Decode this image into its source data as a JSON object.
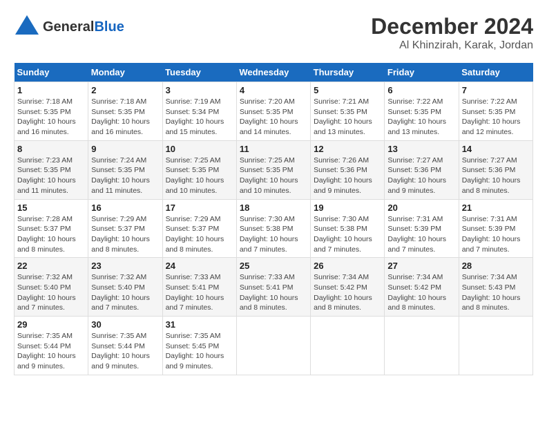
{
  "header": {
    "logo_line1": "General",
    "logo_line2": "Blue",
    "month": "December 2024",
    "location": "Al Khinzirah, Karak, Jordan"
  },
  "days_of_week": [
    "Sunday",
    "Monday",
    "Tuesday",
    "Wednesday",
    "Thursday",
    "Friday",
    "Saturday"
  ],
  "weeks": [
    [
      {
        "day": "1",
        "sunrise": "7:18 AM",
        "sunset": "5:35 PM",
        "daylight": "10 hours and 16 minutes."
      },
      {
        "day": "2",
        "sunrise": "7:18 AM",
        "sunset": "5:35 PM",
        "daylight": "10 hours and 16 minutes."
      },
      {
        "day": "3",
        "sunrise": "7:19 AM",
        "sunset": "5:34 PM",
        "daylight": "10 hours and 15 minutes."
      },
      {
        "day": "4",
        "sunrise": "7:20 AM",
        "sunset": "5:35 PM",
        "daylight": "10 hours and 14 minutes."
      },
      {
        "day": "5",
        "sunrise": "7:21 AM",
        "sunset": "5:35 PM",
        "daylight": "10 hours and 13 minutes."
      },
      {
        "day": "6",
        "sunrise": "7:22 AM",
        "sunset": "5:35 PM",
        "daylight": "10 hours and 13 minutes."
      },
      {
        "day": "7",
        "sunrise": "7:22 AM",
        "sunset": "5:35 PM",
        "daylight": "10 hours and 12 minutes."
      }
    ],
    [
      {
        "day": "8",
        "sunrise": "7:23 AM",
        "sunset": "5:35 PM",
        "daylight": "10 hours and 11 minutes."
      },
      {
        "day": "9",
        "sunrise": "7:24 AM",
        "sunset": "5:35 PM",
        "daylight": "10 hours and 11 minutes."
      },
      {
        "day": "10",
        "sunrise": "7:25 AM",
        "sunset": "5:35 PM",
        "daylight": "10 hours and 10 minutes."
      },
      {
        "day": "11",
        "sunrise": "7:25 AM",
        "sunset": "5:35 PM",
        "daylight": "10 hours and 10 minutes."
      },
      {
        "day": "12",
        "sunrise": "7:26 AM",
        "sunset": "5:36 PM",
        "daylight": "10 hours and 9 minutes."
      },
      {
        "day": "13",
        "sunrise": "7:27 AM",
        "sunset": "5:36 PM",
        "daylight": "10 hours and 9 minutes."
      },
      {
        "day": "14",
        "sunrise": "7:27 AM",
        "sunset": "5:36 PM",
        "daylight": "10 hours and 8 minutes."
      }
    ],
    [
      {
        "day": "15",
        "sunrise": "7:28 AM",
        "sunset": "5:37 PM",
        "daylight": "10 hours and 8 minutes."
      },
      {
        "day": "16",
        "sunrise": "7:29 AM",
        "sunset": "5:37 PM",
        "daylight": "10 hours and 8 minutes."
      },
      {
        "day": "17",
        "sunrise": "7:29 AM",
        "sunset": "5:37 PM",
        "daylight": "10 hours and 8 minutes."
      },
      {
        "day": "18",
        "sunrise": "7:30 AM",
        "sunset": "5:38 PM",
        "daylight": "10 hours and 7 minutes."
      },
      {
        "day": "19",
        "sunrise": "7:30 AM",
        "sunset": "5:38 PM",
        "daylight": "10 hours and 7 minutes."
      },
      {
        "day": "20",
        "sunrise": "7:31 AM",
        "sunset": "5:39 PM",
        "daylight": "10 hours and 7 minutes."
      },
      {
        "day": "21",
        "sunrise": "7:31 AM",
        "sunset": "5:39 PM",
        "daylight": "10 hours and 7 minutes."
      }
    ],
    [
      {
        "day": "22",
        "sunrise": "7:32 AM",
        "sunset": "5:40 PM",
        "daylight": "10 hours and 7 minutes."
      },
      {
        "day": "23",
        "sunrise": "7:32 AM",
        "sunset": "5:40 PM",
        "daylight": "10 hours and 7 minutes."
      },
      {
        "day": "24",
        "sunrise": "7:33 AM",
        "sunset": "5:41 PM",
        "daylight": "10 hours and 7 minutes."
      },
      {
        "day": "25",
        "sunrise": "7:33 AM",
        "sunset": "5:41 PM",
        "daylight": "10 hours and 8 minutes."
      },
      {
        "day": "26",
        "sunrise": "7:34 AM",
        "sunset": "5:42 PM",
        "daylight": "10 hours and 8 minutes."
      },
      {
        "day": "27",
        "sunrise": "7:34 AM",
        "sunset": "5:42 PM",
        "daylight": "10 hours and 8 minutes."
      },
      {
        "day": "28",
        "sunrise": "7:34 AM",
        "sunset": "5:43 PM",
        "daylight": "10 hours and 8 minutes."
      }
    ],
    [
      {
        "day": "29",
        "sunrise": "7:35 AM",
        "sunset": "5:44 PM",
        "daylight": "10 hours and 9 minutes."
      },
      {
        "day": "30",
        "sunrise": "7:35 AM",
        "sunset": "5:44 PM",
        "daylight": "10 hours and 9 minutes."
      },
      {
        "day": "31",
        "sunrise": "7:35 AM",
        "sunset": "5:45 PM",
        "daylight": "10 hours and 9 minutes."
      },
      null,
      null,
      null,
      null
    ]
  ]
}
